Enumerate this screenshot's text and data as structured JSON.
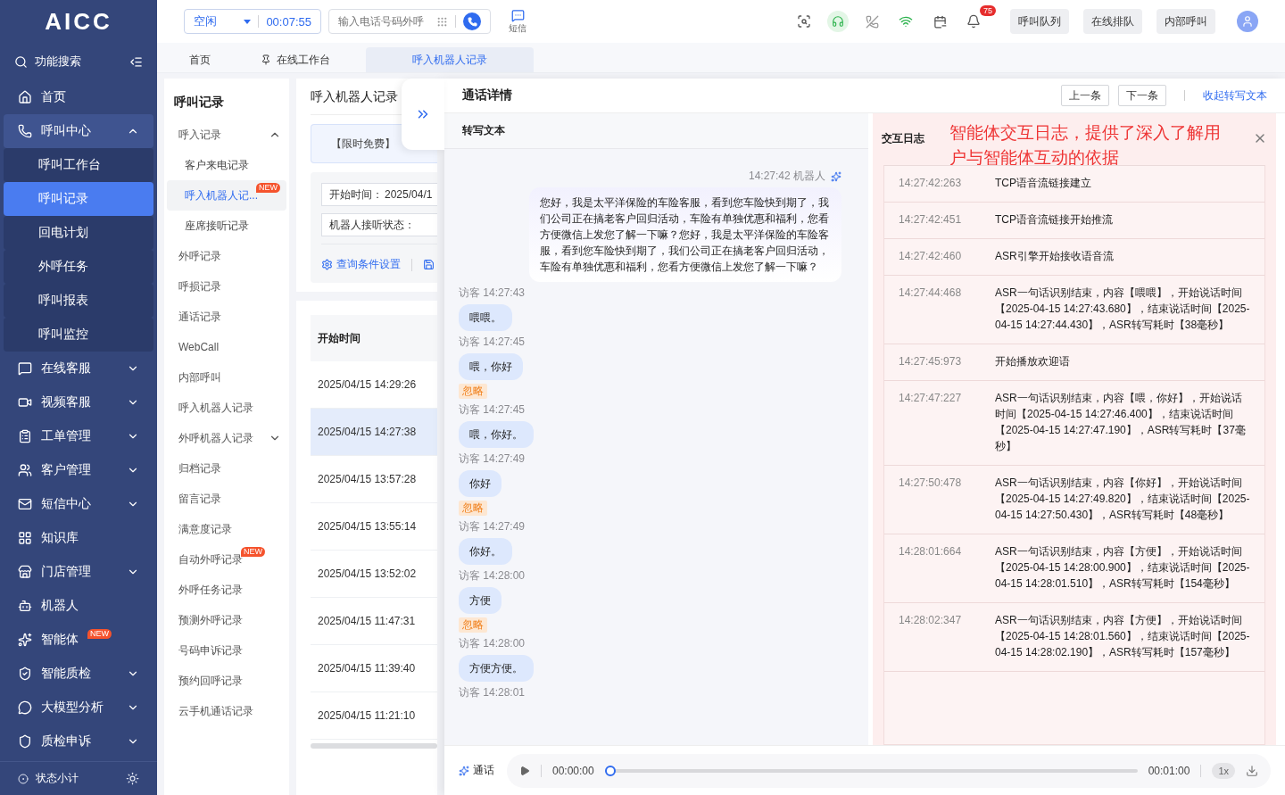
{
  "logo": "AICC",
  "sidebar": {
    "search": "功能搜索",
    "items": [
      {
        "label": "首页"
      },
      {
        "label": "呼叫中心",
        "expanded": true,
        "children": [
          {
            "label": "呼叫工作台",
            "selected": false
          },
          {
            "label": "呼叫记录",
            "selected": true
          },
          {
            "label": "回电计划",
            "selected": false
          },
          {
            "label": "外呼任务",
            "selected": false
          },
          {
            "label": "呼叫报表",
            "selected": false
          },
          {
            "label": "呼叫监控",
            "selected": false
          }
        ]
      },
      {
        "label": "在线客服",
        "expanded": false
      },
      {
        "label": "视频客服",
        "expanded": false
      },
      {
        "label": "工单管理",
        "expanded": false
      },
      {
        "label": "客户管理",
        "expanded": false
      },
      {
        "label": "短信中心",
        "expanded": false
      },
      {
        "label": "知识库"
      },
      {
        "label": "门店管理",
        "expanded": false
      },
      {
        "label": "机器人"
      },
      {
        "label": "智能体",
        "badge": "NEW"
      },
      {
        "label": "智能质检",
        "expanded": false
      },
      {
        "label": "大模型分析",
        "expanded": false
      },
      {
        "label": "质检申诉",
        "expanded": false
      }
    ],
    "footer": "状态小计"
  },
  "topbar": {
    "status": "空闲",
    "timer": "00:07:55",
    "dial_placeholder": "输入电话号码外呼",
    "sms": "短信",
    "notifications": "75",
    "buttons": [
      "呼叫队列",
      "在线排队",
      "内部呼叫"
    ]
  },
  "tabs": [
    {
      "label": "首页",
      "selected": false,
      "pinned": false
    },
    {
      "label": "在线工作台",
      "selected": false,
      "pinned": true
    },
    {
      "label": "呼入机器人记录",
      "selected": true,
      "pinned": false
    }
  ],
  "subnav": {
    "title": "呼叫记录",
    "items": [
      {
        "label": "呼入记录",
        "selected": false,
        "expanded": true,
        "children": [
          {
            "label": "客户来电记录",
            "selected": false
          },
          {
            "label": "呼入机器人记...",
            "selected": true,
            "badge": "NEW"
          },
          {
            "label": "座席接听记录",
            "selected": false
          }
        ]
      },
      {
        "label": "外呼记录",
        "selected": false
      },
      {
        "label": "呼损记录",
        "selected": false
      },
      {
        "label": "通话记录",
        "selected": false
      },
      {
        "label": "WebCall",
        "selected": false
      },
      {
        "label": "内部呼叫",
        "selected": false
      },
      {
        "label": "呼入机器人记录",
        "selected": false
      },
      {
        "label": "外呼机器人记录",
        "selected": false,
        "expanded": false
      },
      {
        "label": "归档记录",
        "selected": false
      },
      {
        "label": "留言记录",
        "selected": false
      },
      {
        "label": "满意度记录",
        "selected": false
      },
      {
        "label": "自动外呼记录",
        "selected": false,
        "badge": "NEW"
      },
      {
        "label": "外呼任务记录",
        "selected": false
      },
      {
        "label": "预测外呼记录",
        "selected": false
      },
      {
        "label": "号码申诉记录",
        "selected": false
      },
      {
        "label": "预约回呼记录",
        "selected": false
      },
      {
        "label": "云手机通话记录",
        "selected": false
      }
    ]
  },
  "records": {
    "title": "呼入机器人记录",
    "notice": "【限时免费】",
    "filters": [
      {
        "label": "开始时间：",
        "value": "2025/04/1"
      },
      {
        "label": "机器人接听状态："
      }
    ],
    "query_settings": "查询条件设置",
    "table": {
      "columns": [
        "开始时间"
      ],
      "rows": [
        {
          "cells": [
            "2025/04/15 14:29:26"
          ],
          "selected": false
        },
        {
          "cells": [
            "2025/04/15 14:27:38"
          ],
          "selected": true
        },
        {
          "cells": [
            "2025/04/15 13:57:28"
          ],
          "selected": false
        },
        {
          "cells": [
            "2025/04/15 13:55:14"
          ],
          "selected": false
        },
        {
          "cells": [
            "2025/04/15 13:52:02"
          ],
          "selected": false
        },
        {
          "cells": [
            "2025/04/15 11:47:31"
          ],
          "selected": false
        },
        {
          "cells": [
            "2025/04/15 11:39:40"
          ],
          "selected": false
        },
        {
          "cells": [
            "2025/04/15 11:21:10"
          ],
          "selected": false
        }
      ]
    }
  },
  "detail": {
    "title": "通话详情",
    "prev": "上一条",
    "next": "下一条",
    "collapse": "收起转写文本",
    "transcript_title": "转写文本",
    "messages": [
      {
        "kind": "robot",
        "label": "14:27:42 机器人",
        "text": "您好，我是太平洋保险的车险客服，看到您车险快到期了，我们公司正在搞老客户回归活动，车险有单独优惠和福利，您看方便微信上发您了解一下嘛？您好，我是太平洋保险的车险客服，看到您车险快到期了，我们公司正在搞老客户回归活动，车险有单独优惠和福利，您看方便微信上发您了解一下嘛？"
      },
      {
        "kind": "visitor",
        "label": "访客 14:27:43",
        "text": "喂喂。"
      },
      {
        "kind": "visitor",
        "label": "访客 14:27:45",
        "text": "喂，你好",
        "tag": "忽略"
      },
      {
        "kind": "visitor",
        "label": "访客 14:27:45",
        "text": "喂，你好。"
      },
      {
        "kind": "visitor",
        "label": "访客 14:27:49",
        "text": "你好",
        "tag": "忽略"
      },
      {
        "kind": "visitor",
        "label": "访客 14:27:49",
        "text": "你好。"
      },
      {
        "kind": "visitor",
        "label": "访客 14:28:00",
        "text": "方便",
        "tag": "忽略"
      },
      {
        "kind": "visitor",
        "label": "访客 14:28:00",
        "text": "方便方便。"
      },
      {
        "kind": "visitor",
        "label": "访客 14:28:01"
      }
    ],
    "log_title": "交互日志",
    "annotation": "智能体交互日志，提供了深入了解用户与智能体互动的依据",
    "log": [
      {
        "time": "14:27:42:263",
        "text": "TCP语音流链接建立"
      },
      {
        "time": "14:27:42:451",
        "text": "TCP语音流链接开始推流"
      },
      {
        "time": "14:27:42:460",
        "text": "ASR引擎开始接收语音流"
      },
      {
        "time": "14:27:44:468",
        "text": "ASR一句话识别结束，内容【喂喂】，开始说话时间【2025-04-15 14:27:43.680】，结束说话时间【2025-04-15 14:27:44.430】，ASR转写耗时【38毫秒】"
      },
      {
        "time": "14:27:45:973",
        "text": "开始播放欢迎语"
      },
      {
        "time": "14:27:47:227",
        "text": "ASR一句话识别结束，内容【喂，你好】，开始说话时间【2025-04-15 14:27:46.400】，结束说话时间【2025-04-15 14:27:47.190】，ASR转写耗时【37毫秒】"
      },
      {
        "time": "14:27:50:478",
        "text": "ASR一句话识别结束，内容【你好】，开始说话时间【2025-04-15 14:27:49.820】，结束说话时间【2025-04-15 14:27:50.430】，ASR转写耗时【48毫秒】"
      },
      {
        "time": "14:28:01:664",
        "text": "ASR一句话识别结束，内容【方便】，开始说话时间【2025-04-15 14:28:00.900】，结束说话时间【2025-04-15 14:28:01.510】，ASR转写耗时【154毫秒】"
      },
      {
        "time": "14:28:02:347",
        "text": "ASR一句话识别结束，内容【方便】，开始说话时间【2025-04-15 14:28:01.560】，结束说话时间【2025-04-15 14:28:02.190】，ASR转写耗时【157毫秒】"
      }
    ],
    "player": {
      "label": "通话",
      "current": "00:00:00",
      "level": 0,
      "total": "00:01:00",
      "speed": "1x"
    }
  }
}
